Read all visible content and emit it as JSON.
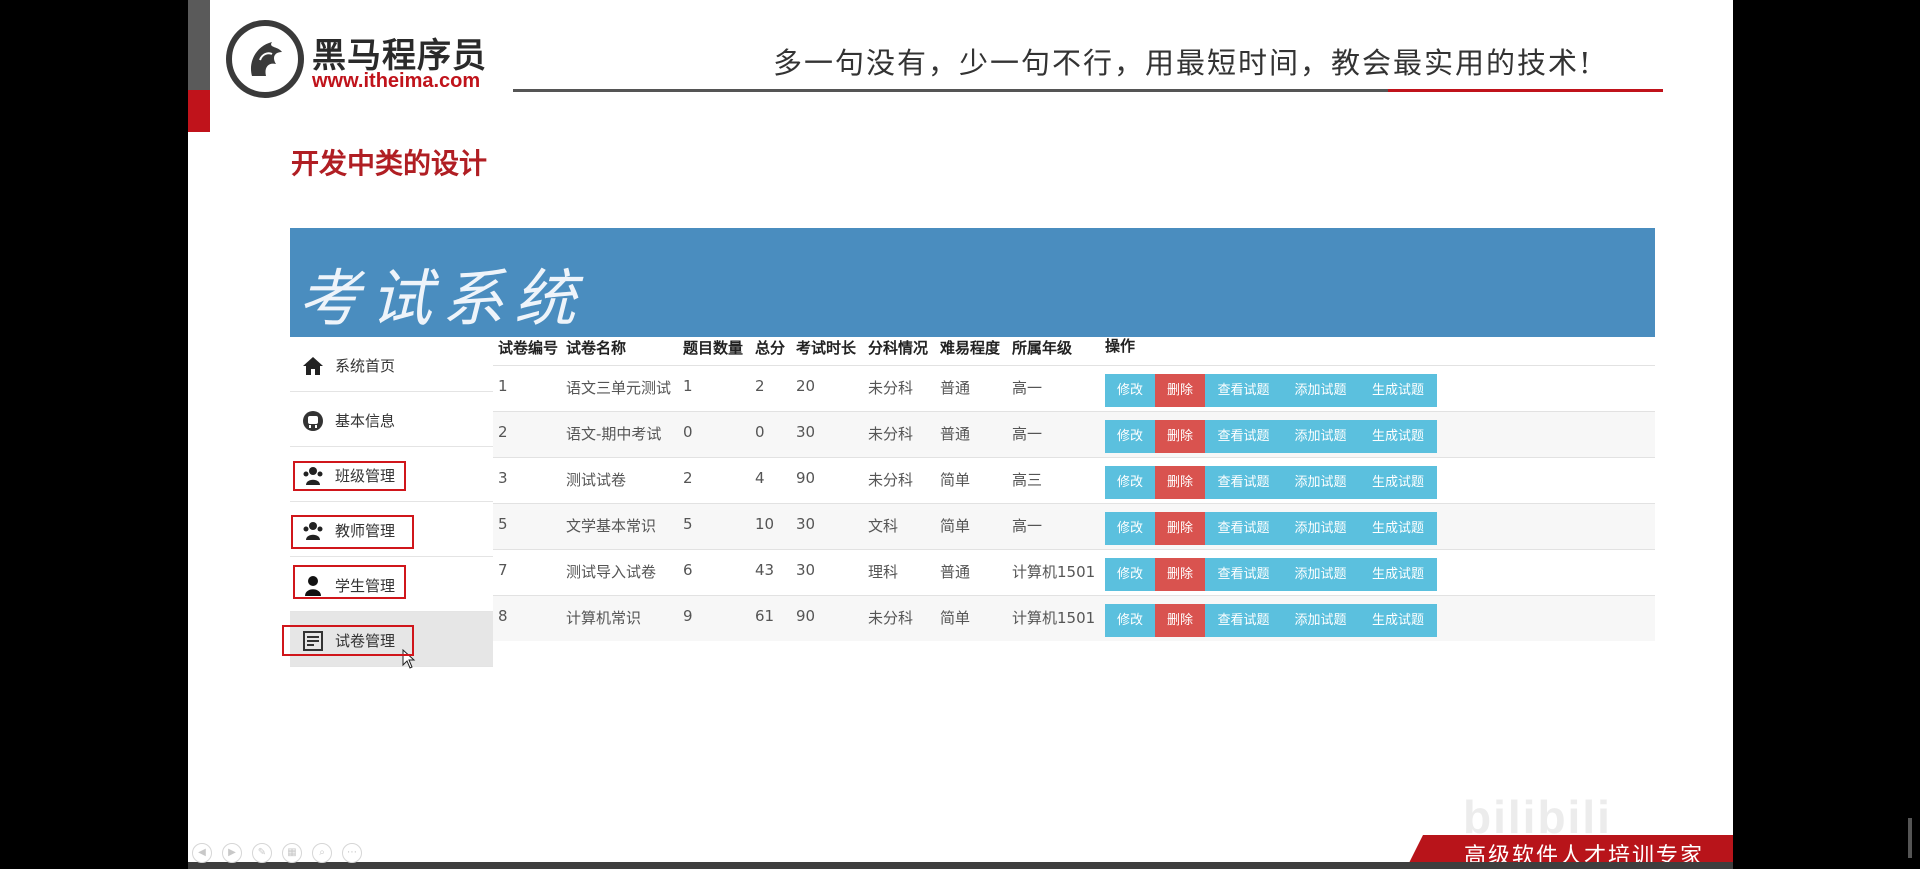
{
  "brand": {
    "name": "黑马程序员",
    "url": "www.itheima.com",
    "slogan": "多一句没有，少一句不行，用最短时间，教会最实用的技术!",
    "footer": "高级软件人才培训专家",
    "accent": "#c0131b"
  },
  "slide": {
    "title": "开发中类的设计"
  },
  "kaoshi": {
    "title": "考试系统",
    "header_color": "#4a8dbf",
    "sidebar": [
      {
        "label": "系统首页",
        "icon": "home-icon"
      },
      {
        "label": "基本信息",
        "icon": "info-circle-icon"
      },
      {
        "label": "班级管理",
        "icon": "group-users-icon"
      },
      {
        "label": "教师管理",
        "icon": "teacher-icon"
      },
      {
        "label": "学生管理",
        "icon": "student-icon"
      },
      {
        "label": "试卷管理",
        "icon": "paper-list-icon"
      }
    ],
    "columns": [
      "试卷编号",
      "试卷名称",
      "题目数量",
      "总分",
      "考试时长",
      "分科情况",
      "难易程度",
      "所属年级",
      "操作"
    ],
    "rows": [
      [
        "1",
        "语文三单元测试",
        "1",
        "2",
        "20",
        "未分科",
        "普通",
        "高一"
      ],
      [
        "2",
        "语文-期中考试",
        "0",
        "0",
        "30",
        "未分科",
        "普通",
        "高一"
      ],
      [
        "3",
        "测试试卷",
        "2",
        "4",
        "90",
        "未分科",
        "简单",
        "高三"
      ],
      [
        "5",
        "文学基本常识",
        "5",
        "10",
        "30",
        "文科",
        "简单",
        "高一"
      ],
      [
        "7",
        "测试导入试卷",
        "6",
        "43",
        "30",
        "理科",
        "普通",
        "计算机1501"
      ],
      [
        "8",
        "计算机常识",
        "9",
        "61",
        "90",
        "未分科",
        "简单",
        "计算机1501"
      ]
    ],
    "actions": [
      "修改",
      "删除",
      "查看试题",
      "添加试题",
      "生成试题"
    ],
    "colors": {
      "info": "#5bc0de",
      "danger": "#d9534f"
    }
  },
  "watermark": "bilibili"
}
